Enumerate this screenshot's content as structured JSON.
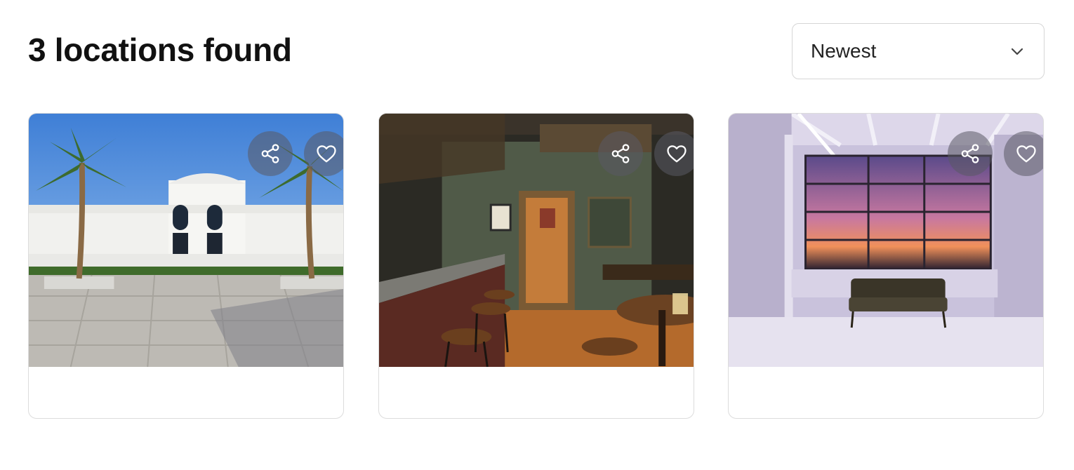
{
  "results": {
    "title": "3 locations found"
  },
  "sort": {
    "selected": "Newest",
    "icon": "chevron-down-icon"
  },
  "cards": [
    {
      "scene": "white-villa-courtyard-with-palm-trees",
      "share_icon": "share-icon",
      "favorite_icon": "heart-icon",
      "favorited": false
    },
    {
      "scene": "moody-bar-interior-with-stools",
      "share_icon": "share-icon",
      "favorite_icon": "heart-icon",
      "favorited": false
    },
    {
      "scene": "white-loft-studio-with-sunset-window-and-sofa",
      "share_icon": "share-icon",
      "favorite_icon": "heart-icon",
      "favorited": false
    }
  ]
}
